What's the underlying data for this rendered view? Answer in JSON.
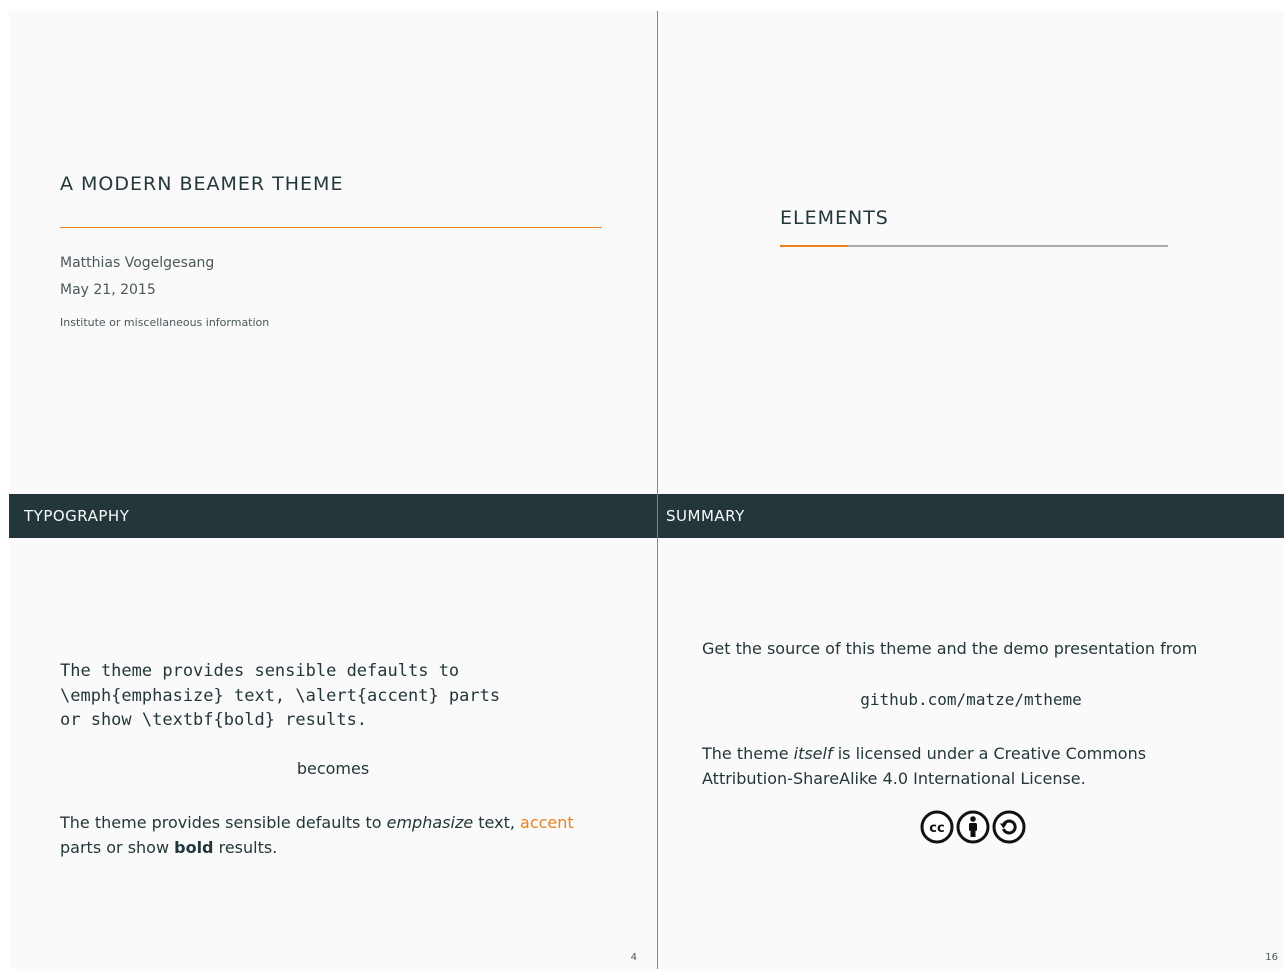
{
  "title_slide": {
    "title": "A MODERN BEAMER THEME",
    "author": "Matthias Vogelgesang",
    "date": "May 21, 2015",
    "institute": "Institute or miscellaneous information"
  },
  "section_slide": {
    "title": "ELEMENTS"
  },
  "typography_slide": {
    "frame_title": "TYPOGRAPHY",
    "code_lines": [
      "The theme provides sensible defaults to",
      "\\emph{emphasize} text, \\alert{accent} parts",
      "or show \\textbf{bold} results."
    ],
    "becomes": "becomes",
    "result": {
      "part1": "The theme provides sensible defaults to ",
      "emph": "emphasize",
      "part2": " text, ",
      "alert": "accent",
      "part3": " parts or show ",
      "bold": "bold",
      "part4": " results."
    },
    "page_number": "4"
  },
  "summary_slide": {
    "frame_title": "SUMMARY",
    "line1": "Get the source of this theme and the demo presentation from",
    "url": "github.com/matze/mtheme",
    "license": {
      "part1": "The theme ",
      "emph": "itself",
      "part2": " is licensed under a Creative Commons Attribution-ShareAlike 4.0 International License."
    },
    "license_icons": [
      "cc-icon",
      "by-icon",
      "sa-icon"
    ],
    "page_number": "16"
  },
  "colors": {
    "background": "#fafafa",
    "dark_teal": "#23373b",
    "accent_orange": "#eb811b",
    "divider": "#7f8a8c"
  }
}
